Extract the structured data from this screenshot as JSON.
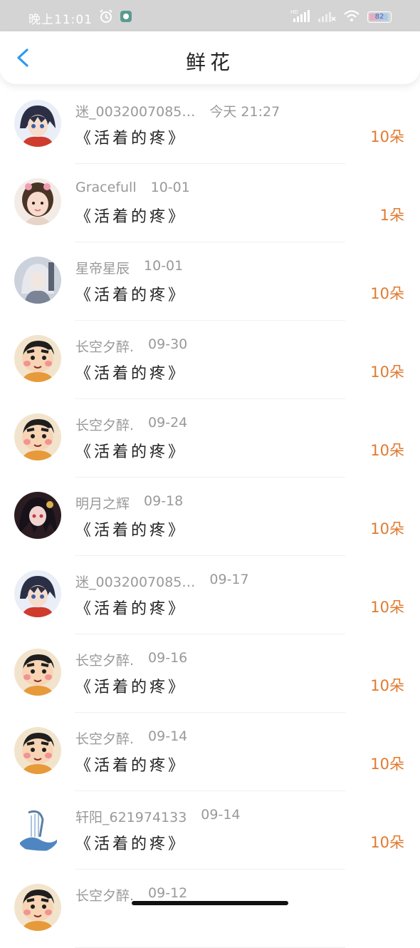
{
  "status_bar": {
    "time": "晚上11:01",
    "battery_level": "82",
    "indicators": [
      "alarm-icon",
      "app-notification-icon",
      "hd-signal-icon",
      "no-signal-icon",
      "wifi-icon",
      "battery-icon"
    ]
  },
  "header": {
    "title": "鲜花",
    "back_icon": "chevron-left-icon"
  },
  "colors": {
    "accent": "#2b9af3",
    "count": "#e07a2f",
    "meta": "#999999",
    "status_bar": "#d4d4d4"
  },
  "items": [
    {
      "user": "迷_0032007085…",
      "date": "今天 21:27",
      "title": "《活着的疼》",
      "count": "10朵",
      "avatar": "anime-boy-red-scarf-avatar"
    },
    {
      "user": "Gracefull",
      "date": "10-01",
      "title": "《活着的疼》",
      "count": "1朵",
      "avatar": "girl-portrait-avatar"
    },
    {
      "user": "星帝星辰",
      "date": "10-01",
      "title": "《活着的疼》",
      "count": "10朵",
      "avatar": "gray-haired-character-avatar"
    },
    {
      "user": "长空夕醉.",
      "date": "09-30",
      "title": "《活着的疼》",
      "count": "10朵",
      "avatar": "crayon-shinchan-avatar"
    },
    {
      "user": "长空夕醉.",
      "date": "09-24",
      "title": "《活着的疼》",
      "count": "10朵",
      "avatar": "crayon-shinchan-avatar"
    },
    {
      "user": "明月之辉",
      "date": "09-18",
      "title": "《活着的疼》",
      "count": "10朵",
      "avatar": "dark-haired-anime-avatar"
    },
    {
      "user": "迷_0032007085…",
      "date": "09-17",
      "title": "《活着的疼》",
      "count": "10朵",
      "avatar": "anime-boy-red-scarf-avatar"
    },
    {
      "user": "长空夕醉.",
      "date": "09-16",
      "title": "《活着的疼》",
      "count": "10朵",
      "avatar": "crayon-shinchan-avatar"
    },
    {
      "user": "长空夕醉.",
      "date": "09-14",
      "title": "《活着的疼》",
      "count": "10朵",
      "avatar": "crayon-shinchan-avatar"
    },
    {
      "user": "轩阳_621974133",
      "date": "09-14",
      "title": "《活着的疼》",
      "count": "10朵",
      "avatar": "blue-harp-avatar"
    },
    {
      "user": "长空夕醉.",
      "date": "09-12",
      "title": "",
      "count": "",
      "avatar": "crayon-shinchan-avatar"
    }
  ]
}
